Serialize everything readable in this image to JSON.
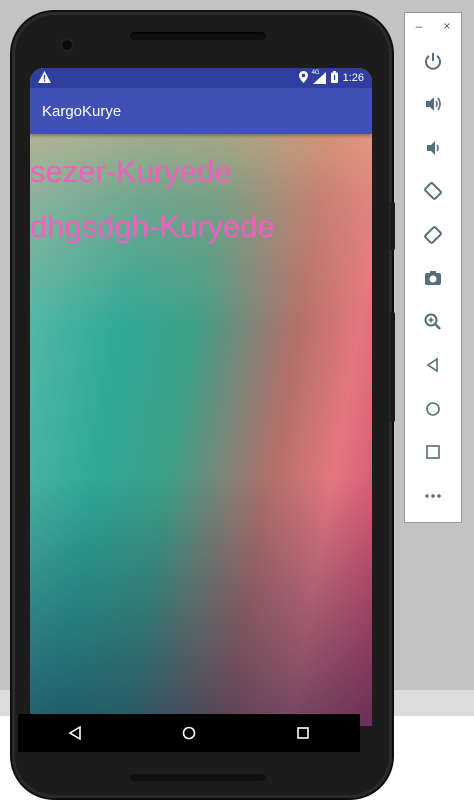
{
  "app": {
    "title": "KargoKurye"
  },
  "statusbar": {
    "time": "1:26",
    "warning_icon": "warning-icon",
    "location_icon": "location-icon",
    "signal_label": "4G",
    "battery_icon": "battery-icon"
  },
  "list": {
    "items": [
      "sezer-Kuryede",
      "dhgsdgh-Kuryede"
    ]
  },
  "navbar": {
    "back": "back-icon",
    "home": "home-icon",
    "recents": "recents-icon"
  },
  "panel": {
    "minimize": "–",
    "close": "×",
    "tools": [
      "power-icon",
      "volume-up-icon",
      "volume-down-icon",
      "rotate-left-icon",
      "rotate-right-icon",
      "camera-icon",
      "zoom-icon",
      "back-icon",
      "home-icon",
      "overview-icon",
      "more-icon"
    ]
  },
  "colors": {
    "statusbar": "#303f9f",
    "appbar": "#3f51b5",
    "list_text": "#f25ec2"
  }
}
